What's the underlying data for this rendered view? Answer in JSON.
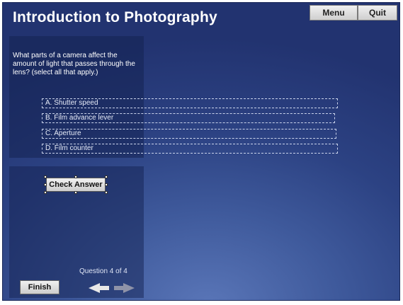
{
  "header": {
    "title": "Introduction to Photography",
    "menu_label": "Menu",
    "quit_label": "Quit"
  },
  "question": {
    "text": "What parts of a camera affect the amount of light that passes through the lens? (select all that apply.)",
    "options": [
      {
        "letter": "A.",
        "label": "Shutter speed"
      },
      {
        "letter": "B.",
        "label": "Film advance lever"
      },
      {
        "letter": "C.",
        "label": "Aperture"
      },
      {
        "letter": "D.",
        "label": "Film counter"
      }
    ]
  },
  "controls": {
    "check_label": "Check Answer",
    "question_counter": "Question 4  of 4",
    "finish_label": "Finish"
  },
  "icons": {
    "prev": "back-arrow-icon",
    "next": "forward-arrow-icon"
  },
  "colors": {
    "background": "#2c4283",
    "arrow_active": "#e8e8e8",
    "arrow_inactive": "#8f93a8"
  }
}
